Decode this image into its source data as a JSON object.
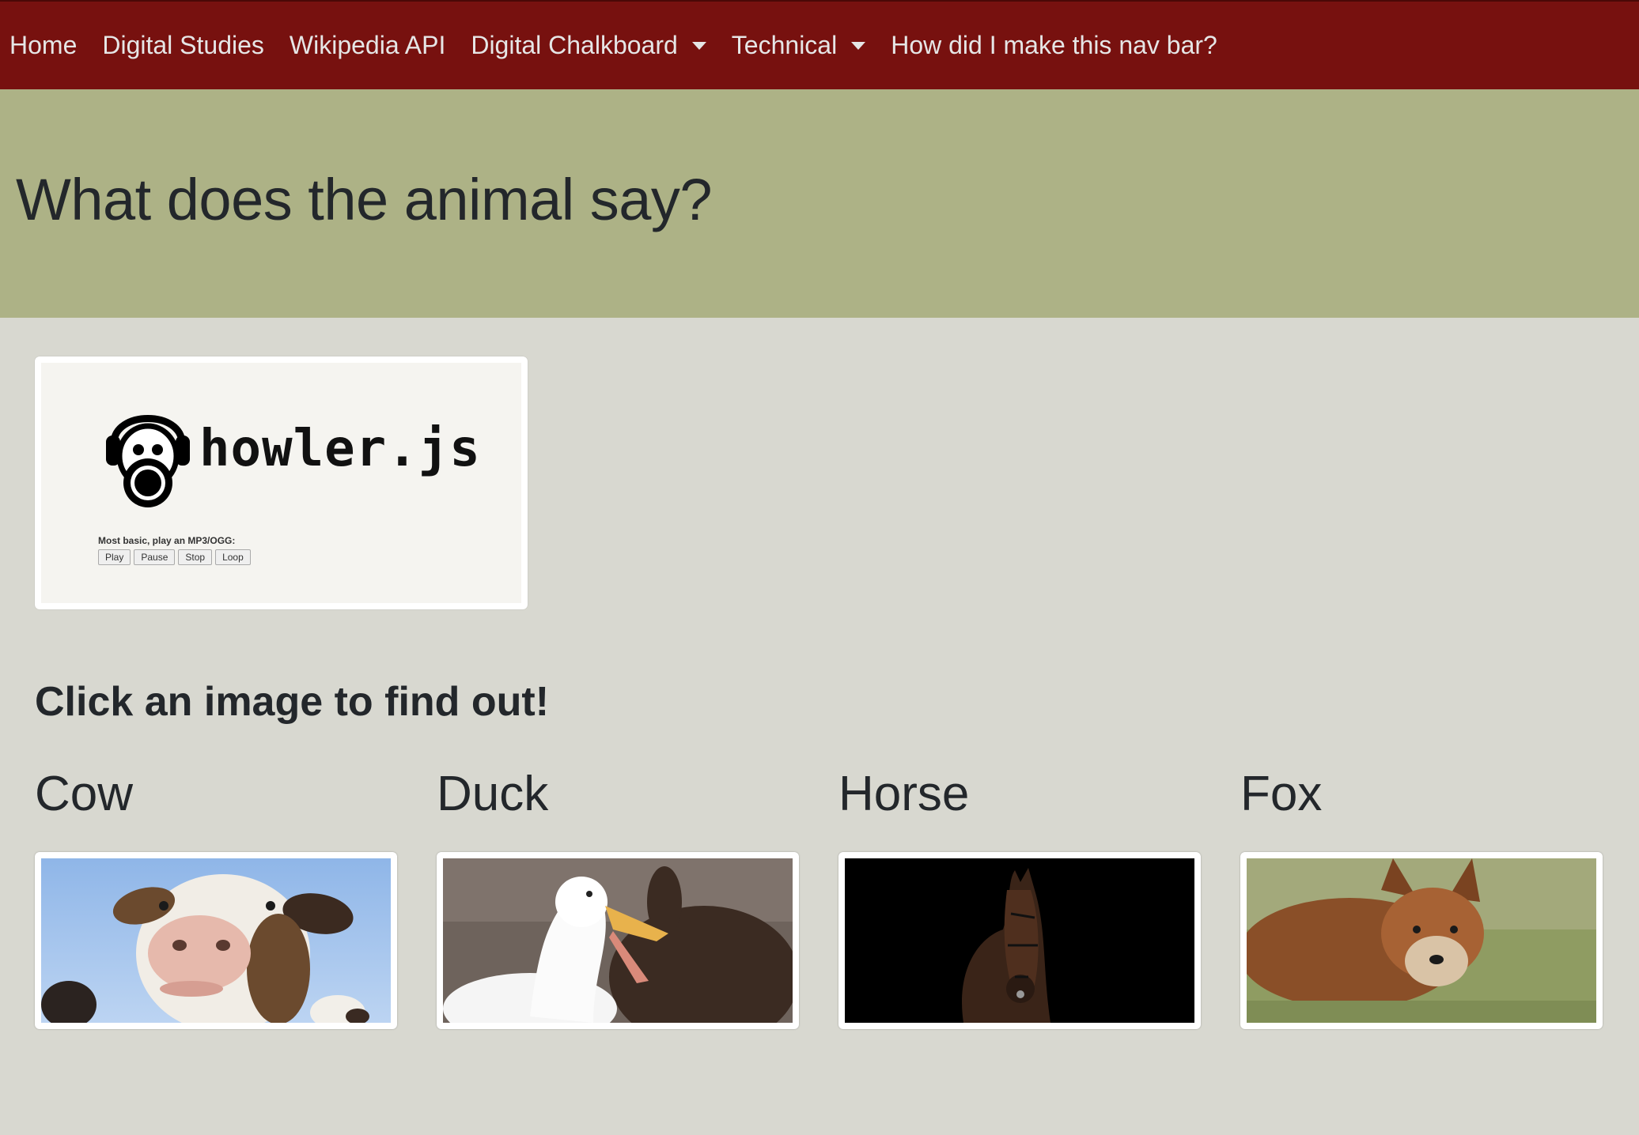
{
  "nav": {
    "items": [
      {
        "label": "Home",
        "dropdown": false
      },
      {
        "label": "Digital Studies",
        "dropdown": false
      },
      {
        "label": "Wikipedia API",
        "dropdown": false
      },
      {
        "label": "Digital Chalkboard",
        "dropdown": true
      },
      {
        "label": "Technical",
        "dropdown": true
      },
      {
        "label": "How did I make this nav bar?",
        "dropdown": false
      }
    ]
  },
  "header": {
    "title": "What does the animal say?"
  },
  "howler": {
    "logo_text": "howler.js",
    "caption": "Most basic, play an MP3/OGG:",
    "buttons": [
      "Play",
      "Pause",
      "Stop",
      "Loop"
    ]
  },
  "main": {
    "instruction": "Click an image to find out!",
    "animals": [
      {
        "name": "Cow"
      },
      {
        "name": "Duck"
      },
      {
        "name": "Horse"
      },
      {
        "name": "Fox"
      }
    ]
  },
  "colors": {
    "navbar": "#77110f",
    "jumbotron": "#adb286",
    "page_background": "#d8d8d0"
  }
}
